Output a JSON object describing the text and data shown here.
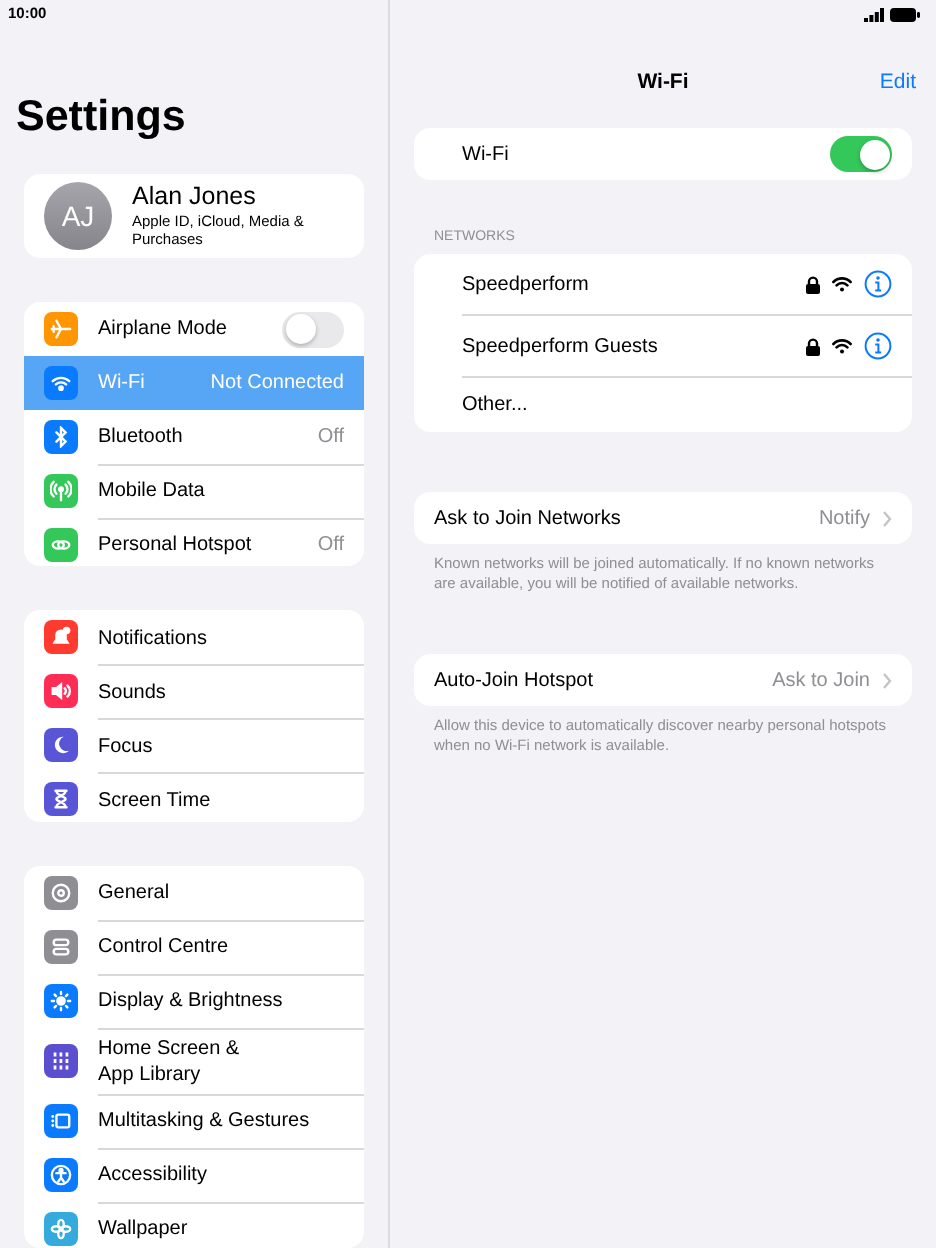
{
  "status_bar": {
    "time": "10:00"
  },
  "sidebar": {
    "title": "Settings",
    "profile": {
      "initials": "AJ",
      "name": "Alan Jones",
      "subtitle": "Apple ID, iCloud, Media & Purchases"
    },
    "groups": [
      [
        {
          "label": "Airplane Mode",
          "color": "#ff9500",
          "kind": "toggle",
          "on": false,
          "selected": false
        },
        {
          "label": "Wi-Fi",
          "color": "#0a7aff",
          "kind": "value",
          "value": "Not Connected",
          "selected": true
        },
        {
          "label": "Bluetooth",
          "color": "#0a7aff",
          "kind": "value",
          "value": "Off",
          "selected": false
        },
        {
          "label": "Mobile Data",
          "color": "#34c759",
          "kind": "plain",
          "selected": false
        },
        {
          "label": "Personal Hotspot",
          "color": "#34c759",
          "kind": "value",
          "value": "Off",
          "selected": false
        }
      ],
      [
        {
          "label": "Notifications",
          "color": "#ff3b30",
          "kind": "plain",
          "selected": false
        },
        {
          "label": "Sounds",
          "color": "#ff2d55",
          "kind": "plain",
          "selected": false
        },
        {
          "label": "Focus",
          "color": "#5856d6",
          "kind": "plain",
          "selected": false
        },
        {
          "label": "Screen Time",
          "color": "#5856d6",
          "kind": "plain",
          "selected": false
        }
      ],
      [
        {
          "label": "General",
          "color": "#8e8e93",
          "kind": "plain",
          "selected": false
        },
        {
          "label": "Control Centre",
          "color": "#8e8e93",
          "kind": "plain",
          "selected": false
        },
        {
          "label": "Display & Brightness",
          "color": "#0a7aff",
          "kind": "plain",
          "selected": false
        },
        {
          "label": "Home Screen &\nApp Library",
          "color": "#5b4fcf",
          "kind": "plain",
          "selected": false
        },
        {
          "label": "Multitasking & Gestures",
          "color": "#0a7aff",
          "kind": "plain",
          "selected": false
        },
        {
          "label": "Accessibility",
          "color": "#0a7aff",
          "kind": "plain",
          "selected": false
        },
        {
          "label": "Wallpaper",
          "color": "#35aadc",
          "kind": "plain",
          "selected": false
        }
      ]
    ]
  },
  "detail": {
    "title": "Wi-Fi",
    "edit": "Edit",
    "wifi_toggle": {
      "label": "Wi-Fi",
      "on": true
    },
    "networks_header": "NETWORKS",
    "networks": [
      {
        "kind": "network",
        "name": "Speedperform",
        "secured": true
      },
      {
        "kind": "network",
        "name": "Speedperform Guests",
        "secured": true
      },
      {
        "kind": "other",
        "name": "Other..."
      }
    ],
    "options": [
      {
        "label": "Ask to Join Networks",
        "value": "Notify",
        "footer": "Known networks will be joined automatically. If no known networks are available, you will be notified of available networks."
      },
      {
        "label": "Auto-Join Hotspot",
        "value": "Ask to Join",
        "footer": "Allow this device to automatically discover nearby personal hotspots when no Wi-Fi network is available."
      }
    ]
  }
}
